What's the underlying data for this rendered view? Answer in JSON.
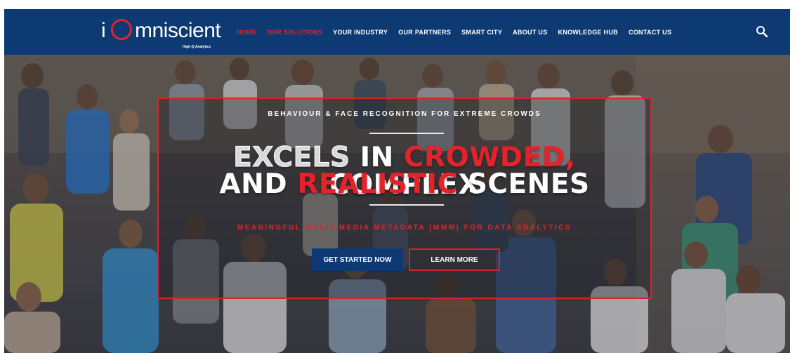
{
  "brand": {
    "logo_prefix": "i",
    "logo_word": "mniscient",
    "tagline": "High-Q Analytics",
    "accent_color": "#e32329",
    "nav_color": "#0d3a73"
  },
  "nav": {
    "items": [
      {
        "label": "HOME",
        "active": true
      },
      {
        "label": "OUR SOLUTIONS",
        "active": true
      },
      {
        "label": "YOUR INDUSTRY",
        "active": false
      },
      {
        "label": "OUR PARTNERS",
        "active": false
      },
      {
        "label": "SMART CITY",
        "active": false
      },
      {
        "label": "ABOUT US",
        "active": false
      },
      {
        "label": "KNOWLEDGE HUB",
        "active": false
      },
      {
        "label": "CONTACT US",
        "active": false
      }
    ],
    "search_icon": "search-icon"
  },
  "hero": {
    "eyebrow": "BEHAVIOUR & FACE RECOGNITION FOR EXTREME CROWDS",
    "headline_line1": {
      "part1": "EXCELS",
      "part2": " IN ",
      "part3": "CROWDED,",
      "part4": " COMPLEX"
    },
    "headline_line2": {
      "part1": "AND ",
      "part2": "REALISTIC",
      "part3": " SCENES"
    },
    "subheadline": "MEANINGFUL MULTI-MEDIA METADATA (MMM) FOR DATA ANALYTICS",
    "cta_primary": "GET STARTED NOW",
    "cta_secondary": "LEARN MORE"
  }
}
